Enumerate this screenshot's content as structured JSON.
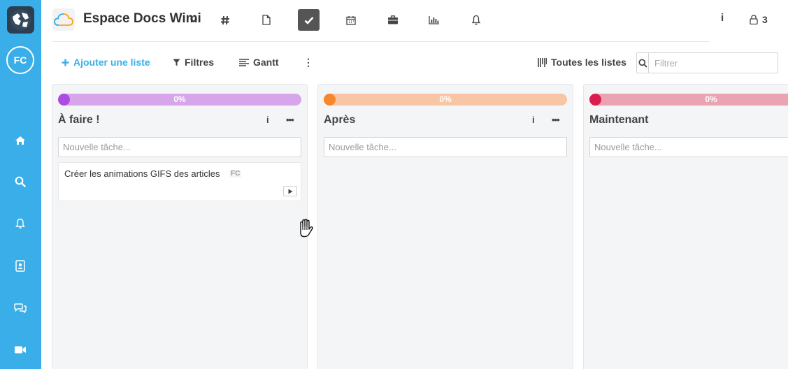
{
  "sidebar": {
    "avatar_initials": "FC",
    "items": [
      {
        "icon": "home-icon"
      },
      {
        "icon": "search-icon"
      },
      {
        "icon": "bell-icon"
      },
      {
        "icon": "contacts-icon"
      },
      {
        "icon": "chat-icon"
      },
      {
        "icon": "video-icon"
      }
    ]
  },
  "header": {
    "space_title": "Espace Docs Wimi",
    "nav_tabs": [
      {
        "icon": "hash-icon"
      },
      {
        "icon": "document-icon"
      },
      {
        "icon": "checkmark-icon",
        "active": true
      },
      {
        "icon": "calendar-icon"
      },
      {
        "icon": "briefcase-icon"
      },
      {
        "icon": "bar-chart-icon"
      },
      {
        "icon": "bell-icon"
      }
    ],
    "info_label": "i",
    "member_count": "3"
  },
  "toolbar": {
    "add_list_label": "Ajouter une liste",
    "filters_label": "Filtres",
    "gantt_label": "Gantt",
    "more_label": "⋮",
    "all_lists_label": "Toutes les listes",
    "filter_placeholder": "Filtrer"
  },
  "columns": [
    {
      "title": "À faire !",
      "progress_label": "0%",
      "progress": 0,
      "bar_color": "#d7a6ea",
      "dot_color": "#a94ee0",
      "new_task_placeholder": "Nouvelle tâche...",
      "info_label": "i",
      "more_label": "•••",
      "tasks": [
        {
          "title": "Créer les animations GIFS des articles",
          "assignee": "FC"
        }
      ]
    },
    {
      "title": "Après",
      "progress_label": "0%",
      "progress": 0,
      "bar_color": "#f8c5a5",
      "dot_color": "#f7872c",
      "new_task_placeholder": "Nouvelle tâche...",
      "info_label": "i",
      "more_label": "•••",
      "tasks": []
    },
    {
      "title": "Maintenant",
      "progress_label": "0%",
      "progress": 0,
      "bar_color": "#eaa3b3",
      "dot_color": "#dc1c4e",
      "new_task_placeholder": "Nouvelle tâche...",
      "info_label": "i",
      "more_label": "•••",
      "tasks": []
    }
  ],
  "colors": {
    "sidebar": "#3aaee8",
    "accent": "#3aaee8",
    "active_tab": "#555555"
  }
}
